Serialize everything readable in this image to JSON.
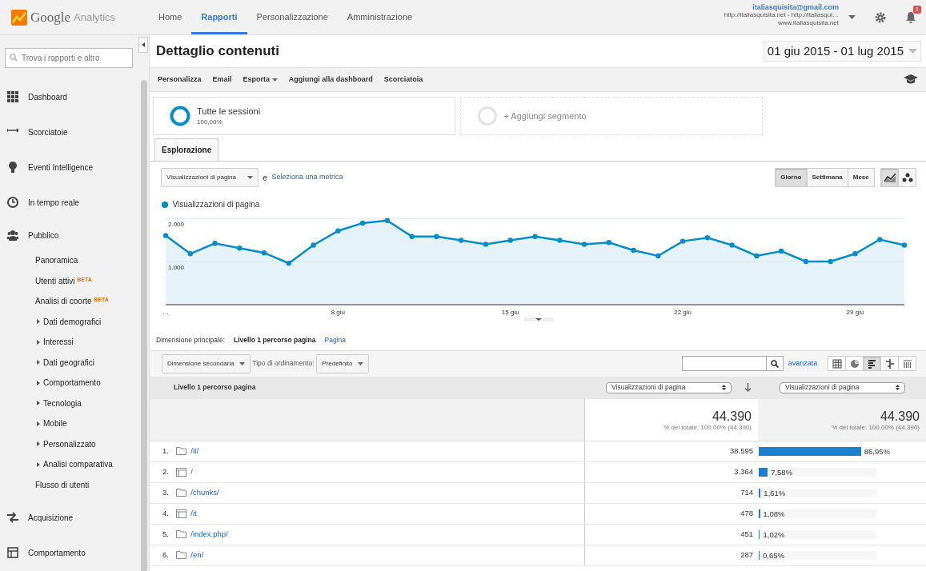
{
  "header": {
    "logo_text": "Google",
    "logo_sub": "Analytics",
    "nav": [
      {
        "label": "Home",
        "selected": false
      },
      {
        "label": "Rapporti",
        "selected": true
      },
      {
        "label": "Personalizzazione",
        "selected": false
      },
      {
        "label": "Amministrazione",
        "selected": false
      }
    ],
    "account": {
      "email": "italiasquisita@gmail.com",
      "property": "http://italiasquisita.net - http://italiasqui…",
      "view": "www.italiasquisita.net"
    },
    "notifications": "1"
  },
  "sidebar": {
    "search": {
      "placeholder": "Trova i rapporti e altro"
    },
    "items": [
      {
        "label": "Dashboard",
        "kind": "section"
      },
      {
        "label": "Scorciatoie",
        "kind": "section"
      },
      {
        "label": "Eventi Intelligence",
        "kind": "section"
      },
      {
        "label": "In tempo reale",
        "kind": "section"
      },
      {
        "label": "Pubblico",
        "kind": "section",
        "children": [
          {
            "label": "Panoramica",
            "kind": "link"
          },
          {
            "label": "Utenti attivi",
            "kind": "link",
            "badge": "BETA"
          },
          {
            "label": "Analisi di coorte",
            "kind": "link",
            "badge": "BETA"
          },
          {
            "label": "Dati demografici",
            "kind": "group",
            "expanded": false
          },
          {
            "label": "Interessi",
            "kind": "group",
            "expanded": false
          },
          {
            "label": "Dati geografici",
            "kind": "group",
            "expanded": false
          },
          {
            "label": "Comportamento",
            "kind": "group",
            "expanded": false
          },
          {
            "label": "Tecnologia",
            "kind": "group",
            "expanded": false
          },
          {
            "label": "Mobile",
            "kind": "group",
            "expanded": false
          },
          {
            "label": "Personalizzato",
            "kind": "group",
            "expanded": false
          },
          {
            "label": "Analisi comparativa",
            "kind": "group",
            "expanded": false
          },
          {
            "label": "Flusso di utenti",
            "kind": "link"
          }
        ]
      },
      {
        "label": "Acquisizione",
        "kind": "section"
      },
      {
        "label": "Comportamento",
        "kind": "section"
      }
    ]
  },
  "report": {
    "title": "Dettaglio contenuti",
    "date_range": "01 giu 2015 - 01 lug 2015",
    "toolbar": [
      {
        "label": "Personalizza",
        "dropdown": false
      },
      {
        "label": "Email",
        "dropdown": false
      },
      {
        "label": "Esporta",
        "dropdown": true
      },
      {
        "label": "Aggiungi alla dashboard",
        "dropdown": false
      },
      {
        "label": "Scorciatoia",
        "dropdown": false
      }
    ],
    "segments": [
      {
        "kind": "segment",
        "label": "Tutte le sessioni",
        "share": "100,00%"
      },
      {
        "kind": "add",
        "label": "+ Aggiungi segmento"
      }
    ],
    "tabs": [
      {
        "label": "Esplorazione",
        "selected": true
      }
    ],
    "metric": "Visualizzazioni di pagina",
    "conjunction": "e",
    "select_metric": "Seleziona una metrica",
    "periods": [
      {
        "label": "Giorno",
        "selected": true
      },
      {
        "label": "Settimana",
        "selected": false
      },
      {
        "label": "Mese",
        "selected": false
      }
    ],
    "chart_modes": [
      {
        "kind": "line",
        "selected": true
      },
      {
        "kind": "bubble",
        "selected": false
      }
    ],
    "chart_data": {
      "type": "area",
      "series": [
        {
          "name": "Visualizzazioni di pagina",
          "color": "#058dc7",
          "values": [
            1600,
            1180,
            1420,
            1310,
            1200,
            960,
            1380,
            1710,
            1890,
            1950,
            1580,
            1580,
            1490,
            1400,
            1490,
            1580,
            1490,
            1400,
            1440,
            1260,
            1130,
            1470,
            1550,
            1380,
            1130,
            1240,
            1000,
            1000,
            1180,
            1510,
            1380
          ]
        }
      ],
      "ylim": [
        0,
        2000
      ],
      "yticks": [
        {
          "value": 1000,
          "label": "1.000"
        },
        {
          "value": 2000,
          "label": "2.000"
        }
      ],
      "annotations": [
        "…",
        "8 giu",
        "15 giu",
        "22 giu",
        "29 giu"
      ]
    },
    "primary_dimension": {
      "label": "Dimensione principale:",
      "options": [
        {
          "label": "Livello 1 percorso pagina",
          "selected": true
        },
        {
          "label": "Pagina",
          "selected": false
        }
      ]
    },
    "secondary_dimension": "Dimensione secondaria",
    "sort_label": "Tipo di ordinamento:",
    "sort_value": "Predefinito",
    "advanced": "avanzata",
    "views": [
      {
        "kind": "table",
        "selected": false
      },
      {
        "kind": "pie",
        "selected": false
      },
      {
        "kind": "bars",
        "selected": true
      },
      {
        "kind": "compare",
        "selected": false
      },
      {
        "kind": "pivot",
        "selected": false
      }
    ],
    "table": {
      "column_1": "Livello 1 percorso pagina",
      "metric_1": "Visualizzazioni di pagina",
      "metric_2": "Visualizzazioni di pagina",
      "totals": [
        {
          "value": "44.390",
          "share": "% del totale: 100,00% (44.390)"
        },
        {
          "value": "44.390",
          "share": "% del totale: 100,00% (44.390)"
        }
      ],
      "rows": [
        {
          "index": "1.",
          "kind": "folder",
          "path": "/it/",
          "value": "38.595",
          "percent": "86,95%",
          "level": 0.8695
        },
        {
          "index": "2.",
          "kind": "page",
          "path": "/",
          "value": "3.364",
          "percent": "7,58%",
          "level": 0.0758
        },
        {
          "index": "3.",
          "kind": "folder",
          "path": "/chunks/",
          "value": "714",
          "percent": "1,61%",
          "level": 0.0161
        },
        {
          "index": "4.",
          "kind": "page",
          "path": "/it",
          "value": "478",
          "percent": "1,08%",
          "level": 0.0108
        },
        {
          "index": "5.",
          "kind": "folder",
          "path": "/index.php/",
          "value": "451",
          "percent": "1,02%",
          "level": 0.0102
        },
        {
          "index": "6.",
          "kind": "folder",
          "path": "/en/",
          "value": "287",
          "percent": "0,65%",
          "level": 0.0065
        }
      ]
    }
  }
}
